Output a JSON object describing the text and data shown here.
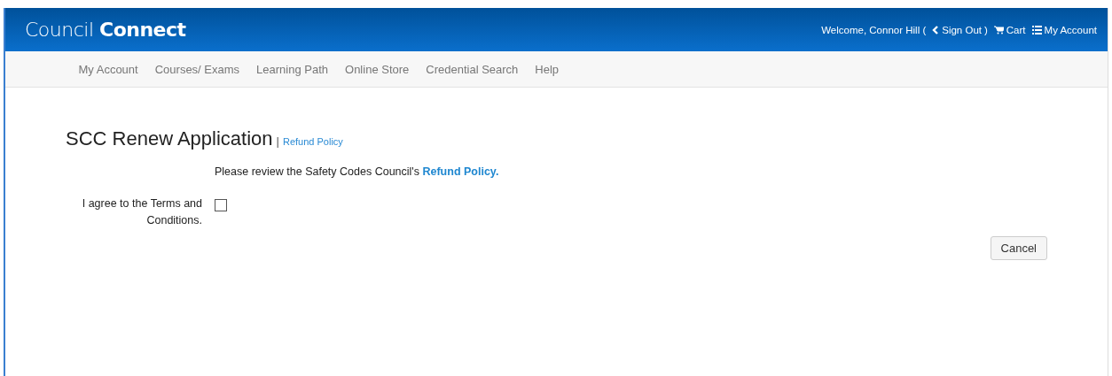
{
  "header": {
    "logo": "Council **Connect**",
    "welcome": "Welcome, Connor Hill (",
    "sign_out": "Sign Out",
    "welcome_end": ")",
    "cart": "Cart",
    "account": "My Account"
  },
  "nav": {
    "items": [
      {
        "label": "My Account"
      },
      {
        "label": "Courses/ Exams"
      },
      {
        "label": "Learning Path"
      },
      {
        "label": "Online Store"
      },
      {
        "label": "Credential Search"
      },
      {
        "label": "Help"
      }
    ]
  },
  "page": {
    "title": "SCC Renew Application",
    "separator": "|",
    "title_link": "Refund Policy",
    "review_text": "Please review the Safety Codes Council's",
    "review_link": "Refund Policy.",
    "terms_label": "I agree to the Terms and Conditions.",
    "terms_checked": false,
    "cancel": "Cancel"
  }
}
